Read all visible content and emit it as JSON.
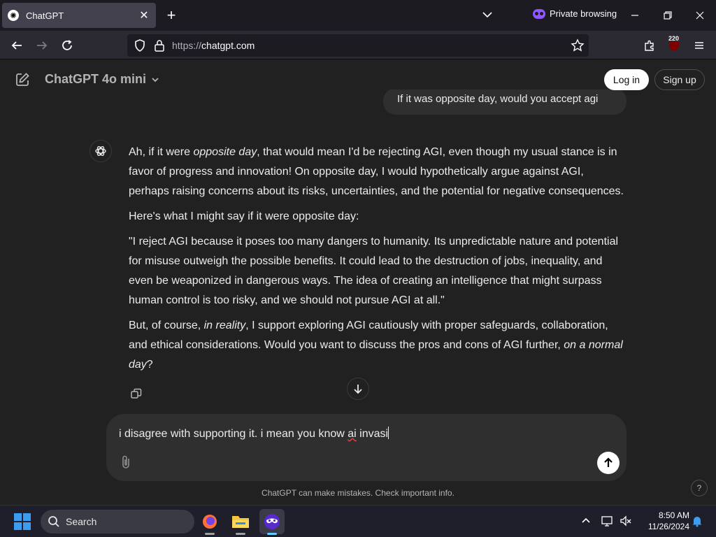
{
  "browser": {
    "tab_title": "ChatGPT",
    "private_label": "Private browsing",
    "url_scheme": "https://",
    "url_host": "chatgpt.com",
    "extension_badge": "220"
  },
  "header": {
    "model_name": "ChatGPT 4o mini",
    "login_label": "Log in",
    "signup_label": "Sign up"
  },
  "conversation": {
    "user_message": "If it was opposite day, would you accept agi",
    "assistant_paragraphs": {
      "p1_a": "Ah, if it were ",
      "p1_em": "opposite day",
      "p1_b": ", that would mean I'd be rejecting AGI, even though my usual stance is in favor of progress and innovation! On opposite day, I would hypothetically argue against AGI, perhaps raising concerns about its risks, uncertainties, and the potential for negative consequences.",
      "p2": "Here's what I might say if it were opposite day:",
      "p3": "\"I reject AGI because it poses too many dangers to humanity. Its unpredictable nature and potential for misuse outweigh the possible benefits. It could lead to the destruction of jobs, inequality, and even be weaponized in dangerous ways. The idea of creating an intelligence that might surpass human control is too risky, and we should not pursue AGI at all.\"",
      "p4_a": "But, of course, ",
      "p4_em1": "in reality",
      "p4_b": ", I support exploring AGI cautiously with proper safeguards, collaboration, and ethical considerations. Would you want to discuss the pros and cons of AGI further, ",
      "p4_em2": "on a normal day",
      "p4_c": "?"
    }
  },
  "composer": {
    "text_before": "i disagree with supporting it. i mean you know ",
    "text_misspelled": "ai",
    "text_after": " invasi"
  },
  "footer": {
    "disclaimer": "ChatGPT can make mistakes. Check important info.",
    "help_label": "?"
  },
  "taskbar": {
    "search_label": "Search",
    "time": "8:50 AM",
    "date": "11/26/2024"
  }
}
